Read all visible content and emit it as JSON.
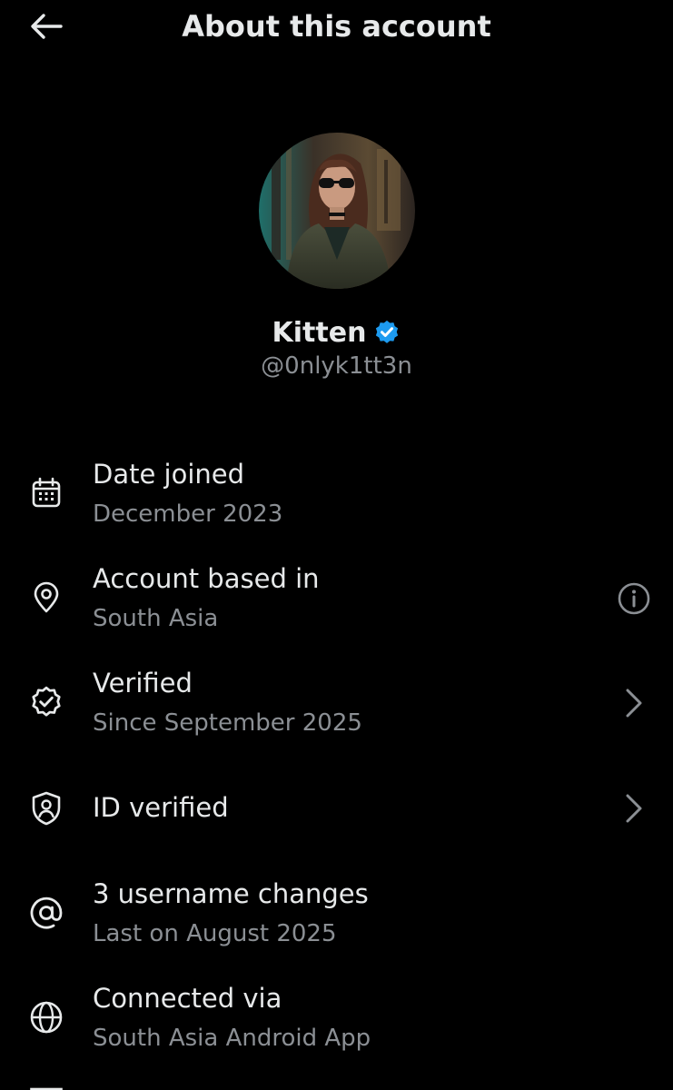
{
  "header": {
    "title": "About this account",
    "back_icon": "arrow-left-icon"
  },
  "profile": {
    "display_name": "Kitten",
    "handle": "@0nlyk1tt3n",
    "verified_badge_color": "#1d9bf0",
    "avatar_description_icon": "avatar-photo"
  },
  "rows": [
    {
      "icon": "calendar-icon",
      "title": "Date joined",
      "subtitle": "December 2023"
    },
    {
      "icon": "location-pin-icon",
      "title": "Account based in",
      "subtitle": "South Asia",
      "right_icon": "info-icon"
    },
    {
      "icon": "verified-badge-outline-icon",
      "title": "Verified",
      "subtitle": "Since September 2025",
      "right_icon": "chevron-right-icon"
    },
    {
      "icon": "shield-user-icon",
      "title": "ID verified",
      "right_icon": "chevron-right-icon"
    },
    {
      "icon": "at-sign-icon",
      "title": "3 username changes",
      "subtitle": "Last on August 2025"
    },
    {
      "icon": "globe-icon",
      "title": "Connected via",
      "subtitle": "South Asia Android App"
    }
  ],
  "colors": {
    "background": "#000000",
    "primary_text": "#e7e9ea",
    "secondary_text": "#8b8f94",
    "accent": "#1d9bf0"
  }
}
